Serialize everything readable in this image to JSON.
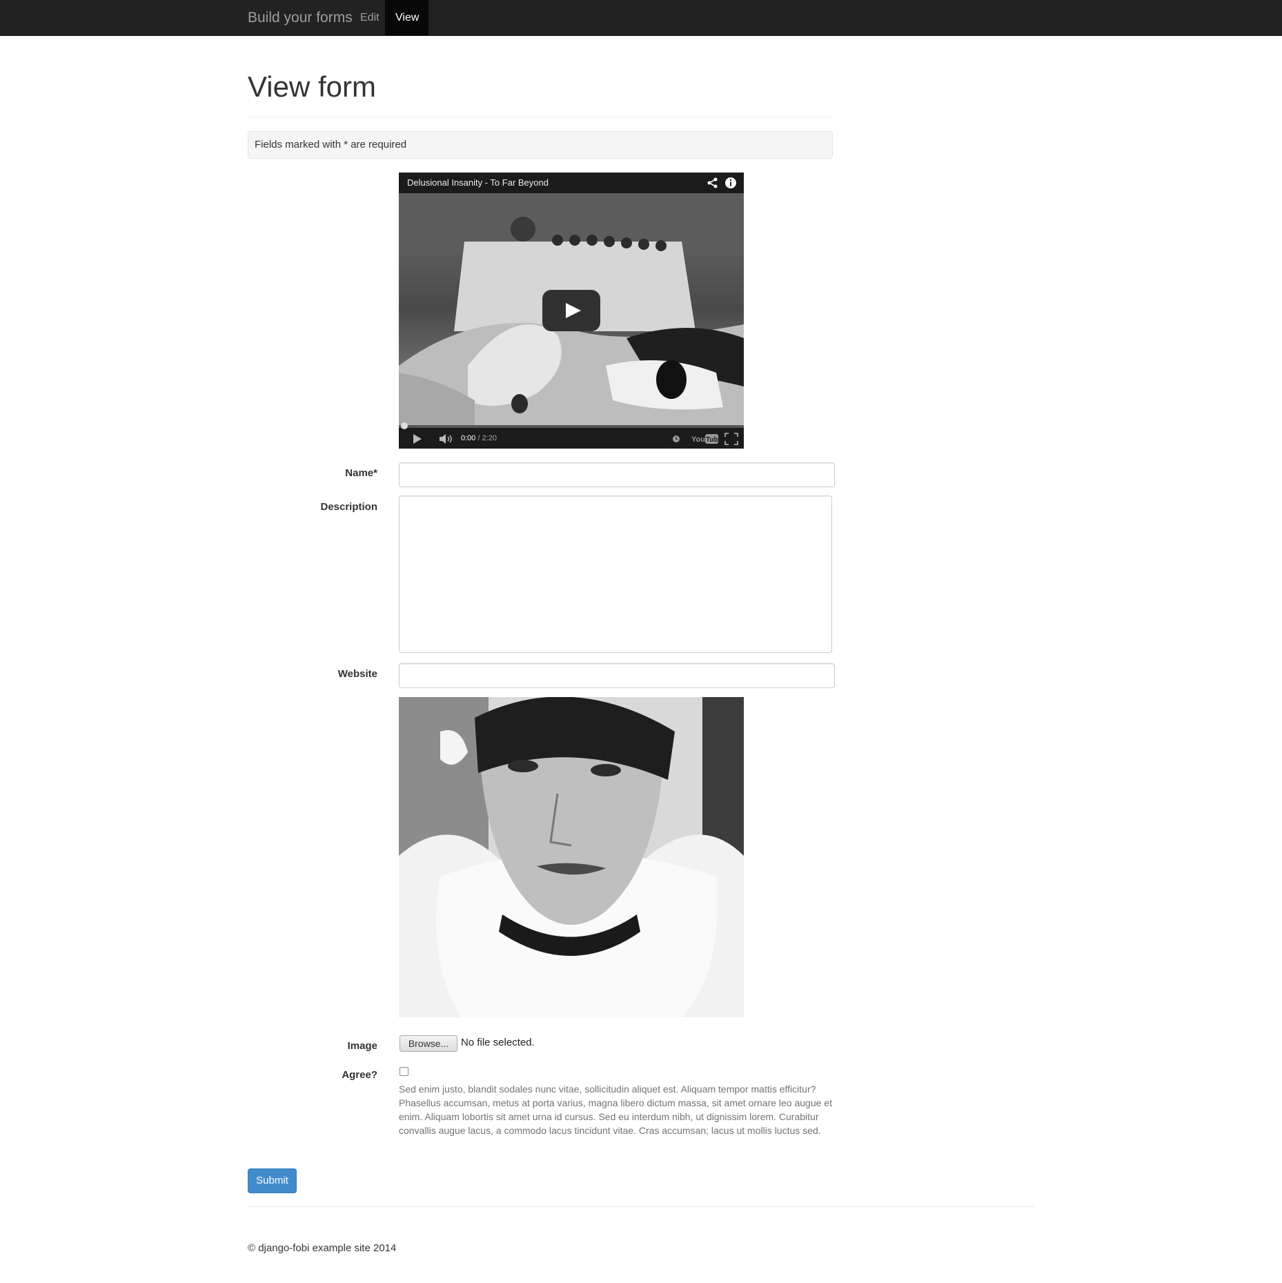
{
  "navbar": {
    "brand": "Build your forms",
    "items": [
      {
        "label": "Edit",
        "active": false
      },
      {
        "label": "View",
        "active": true
      }
    ],
    "bg_color": "#222222"
  },
  "page": {
    "title": "View form",
    "required_note": "Fields marked with * are required"
  },
  "video": {
    "title": "Delusional Insanity - To Far Beyond",
    "current_time": "0:00",
    "duration": "/ 2:20",
    "progress": 0,
    "icons": [
      "share-icon",
      "info-icon",
      "play-icon",
      "volume-icon",
      "clock-icon",
      "youtube-logo",
      "fullscreen-icon"
    ],
    "brand_text": "YouTube"
  },
  "form": {
    "name_label": "Name*",
    "name_value": "",
    "description_label": "Description",
    "description_value": "",
    "website_label": "Website",
    "website_value": "",
    "image_label": "Image",
    "browse_label": "Browse...",
    "file_status": "No file selected.",
    "agree_label": "Agree?",
    "agree_checked": false,
    "agree_help": "Sed enim justo, blandit sodales nunc vitae, sollicitudin aliquet est. Aliquam tempor mattis efficitur? Phasellus accumsan, metus at porta varius, magna libero dictum massa, sit amet ornare leo augue et enim. Aliquam lobortis sit amet urna id cursus. Sed eu interdum nibh, ut dignissim lorem. Curabitur convallis augue lacus, a commodo lacus tincidunt vitae. Cras accumsan; lacus ut mollis luctus sed.",
    "submit_label": "Submit"
  },
  "footer": {
    "text": "© django-fobi example site 2014"
  },
  "colors": {
    "primary": "#428bca",
    "navbar": "#222222",
    "well": "#f5f5f5"
  }
}
